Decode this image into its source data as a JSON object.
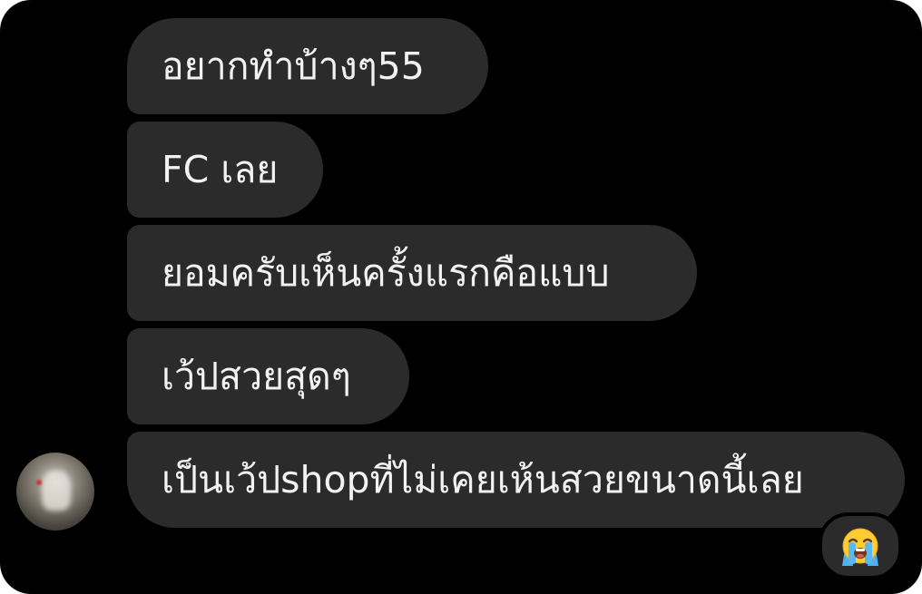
{
  "messages": [
    {
      "text": "อยากทำบ้างๆ55"
    },
    {
      "text": "FC เลย"
    },
    {
      "text": "ยอมครับเห็นครั้งแรกคือแบบ"
    },
    {
      "text": "เว้ปสวยสุดๆ"
    },
    {
      "text": "เป็นเว้ปshopที่ไม่เคยเห้นสวยขนาดนี้เลย"
    }
  ],
  "reaction": {
    "emoji_name": "loudly-crying-face-icon"
  },
  "colors": {
    "background": "#000000",
    "bubble": "#2b2b2b",
    "text": "#f2f2f2"
  }
}
